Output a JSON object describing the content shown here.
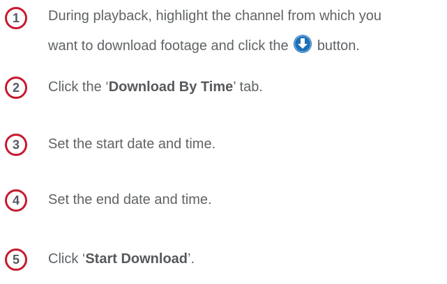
{
  "accent_color": "#c8192f",
  "icon_color": "#1d6fb8",
  "steps": [
    {
      "number": "1",
      "line1": "During playback, highlight the channel from which you",
      "line2_before_icon": "want to download footage and click the",
      "icon": "download-arrow-icon",
      "line2_after_icon": "button."
    },
    {
      "number": "2",
      "text_before": "Click the ‘",
      "bold": "Download By Time",
      "text_after": "’ tab."
    },
    {
      "number": "3",
      "text": "Set the start date and time."
    },
    {
      "number": "4",
      "text": "Set the end date and time."
    },
    {
      "number": "5",
      "text_before": "Click ‘",
      "bold": "Start Download",
      "text_after": "’."
    }
  ]
}
